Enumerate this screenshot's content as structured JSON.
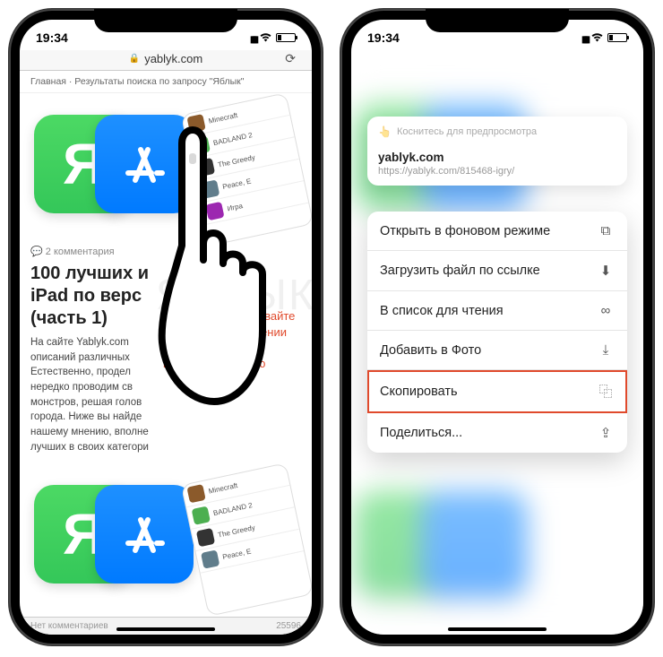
{
  "statusbar": {
    "time": "19:34"
  },
  "left": {
    "address": "yablyk.com",
    "breadcrumb": "Главная  ·  Результаты поиска по запросу \"Яблык\"",
    "ya_letter": "Я",
    "mini_games": [
      {
        "label": "Minecraft"
      },
      {
        "label": "BADLAND 2"
      },
      {
        "label": "The Greedy"
      },
      {
        "label": "Peace, E"
      },
      {
        "label": "Игра"
      }
    ],
    "comments": "2 комментария",
    "article_title_visible": "100 лучших и\niPad по верс\n(часть 1)",
    "article_body_visible": "На сайте Yablyk.com\nописаний различных\nЕстественно, продел\nнередко проводим св\nмонстров, решая голов\nгорода. Ниже вы найде\nнашему мнению, вполне\nлучших в своих категори",
    "instruction": "Нажмите и удерживайте палец на изображении до появления контекстного меню",
    "comments2": "Нет комментариев",
    "views": "25596",
    "watermark": "ЯБЛЫК"
  },
  "right": {
    "preview_hint": "Коснитесь для предпросмотра",
    "preview_domain": "yablyk.com",
    "preview_url": "https://yablyk.com/815468-igry/",
    "menu": [
      {
        "label": "Открыть в фоновом режиме",
        "icon": "⧉"
      },
      {
        "label": "Загрузить файл по ссылке",
        "icon": "⬇"
      },
      {
        "label": "В список для чтения",
        "icon": "∞"
      },
      {
        "label": "Добавить в Фото",
        "icon": "⤓"
      },
      {
        "label": "Скопировать",
        "icon": "⿻",
        "highlighted": true
      },
      {
        "label": "Поделиться...",
        "icon": "⇪"
      }
    ]
  }
}
